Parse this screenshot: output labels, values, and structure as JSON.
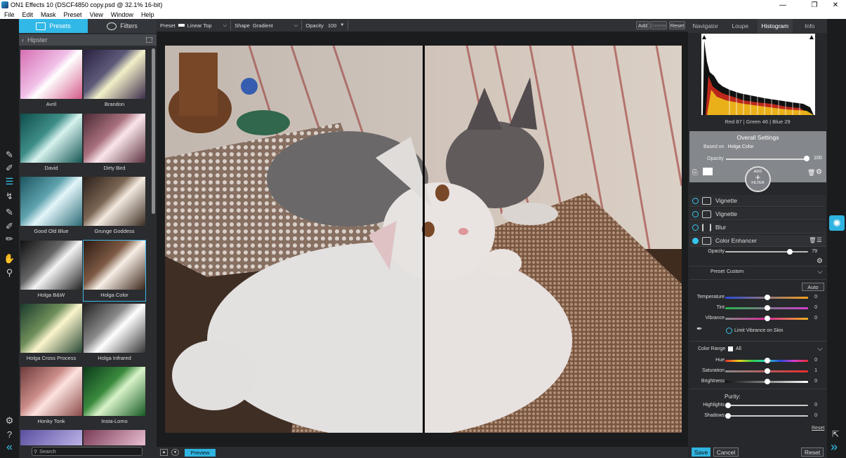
{
  "window": {
    "title": "ON1 Effects 10 (DSCF4850 copy.psd @ 32.1% 16-bit)",
    "minimize": "—",
    "maximize": "❐",
    "close": "✕"
  },
  "menu": [
    "File",
    "Edit",
    "Mask",
    "Preset",
    "View",
    "Window",
    "Help"
  ],
  "browser": {
    "tabs": [
      "Presets",
      "Filters"
    ],
    "category": "Hipster",
    "search_placeholder": "Search",
    "presets": [
      {
        "name": "Avril"
      },
      {
        "name": "Brandon"
      },
      {
        "name": "David"
      },
      {
        "name": "Dirty Bird"
      },
      {
        "name": "Good Old Blue"
      },
      {
        "name": "Grunge Goddess"
      },
      {
        "name": "Holga B&W"
      },
      {
        "name": "Holga Color",
        "selected": true
      },
      {
        "name": "Holga Cross Process"
      },
      {
        "name": "Holga Infrared"
      },
      {
        "name": "Honky Tonk"
      },
      {
        "name": "Insta-Lomo"
      }
    ]
  },
  "options": {
    "preset_label": "Preset",
    "preset_value": "Linear Top",
    "shape_label": "Shape",
    "shape_value": "Gradient",
    "opacity_label": "Opacity",
    "opacity_value": "100",
    "add": "Add",
    "delete": "Delete",
    "reset": "Reset"
  },
  "bottombar": {
    "preview": "Preview"
  },
  "right": {
    "tabs": [
      "Navigator",
      "Loupe",
      "Histogram",
      "Info"
    ],
    "active_tab": "Histogram",
    "rgb": "Red 87 | Green 46 | Blue 29",
    "overall": {
      "title": "Overall Settings",
      "based_on_label": "Based on",
      "based_on_value": "Holga Color",
      "opacity_label": "Opacity",
      "opacity_value": "100",
      "add_label": "ADD",
      "filter_label": "FILTER"
    },
    "filters": [
      "Vignette",
      "Vignette",
      "Blur",
      "Color Enhancer"
    ],
    "enhancer": {
      "opacity_label": "Opacity",
      "opacity_value": "79",
      "preset_label": "Preset",
      "preset_value": "Custom",
      "auto": "Auto",
      "temperature_label": "Temperature",
      "temperature_value": "0",
      "tint_label": "Tint",
      "tint_value": "0",
      "vibrance_label": "Vibrance",
      "vibrance_value": "0",
      "limit_vibrance": "Limit Vibrance on Skin",
      "color_range_label": "Color Range",
      "color_range_value": "All",
      "hue_label": "Hue",
      "hue_value": "0",
      "saturation_label": "Saturation",
      "saturation_value": "1",
      "brightness_label": "Brightness",
      "brightness_value": "0",
      "purity_label": "Purity:",
      "highlights_label": "Highlights",
      "highlights_value": "0",
      "shadows_label": "Shadows",
      "shadows_value": "0",
      "reset": "Reset"
    },
    "save": "Save",
    "cancel": "Cancel",
    "reset": "Reset"
  },
  "colors": {
    "accent": "#31b8e6",
    "panel": "#2a2c2f"
  }
}
